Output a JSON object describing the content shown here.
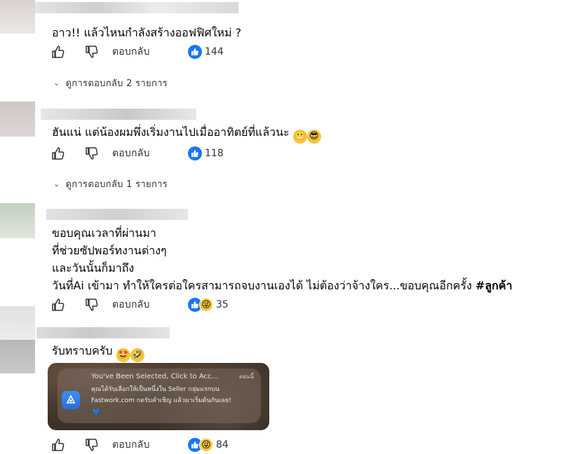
{
  "comments": [
    {
      "text_lines": [
        "อาว!! แล้วไหนกำลังสร้างออฟฟิศใหม่ ?"
      ],
      "reply_label": "ตอบกลับ",
      "reaction_count": "144",
      "view_replies": "ดูการตอบกลับ 2 รายการ"
    },
    {
      "text_lines": [
        "ฮันแน่ แต่น้องผมพึ่งเริ่มงานไปเมื่ออาทิตย์ที่แล้วนะ"
      ],
      "reply_label": "ตอบกลับ",
      "reaction_count": "118",
      "view_replies": "ดูการตอบกลับ 1 รายการ"
    },
    {
      "text_lines": [
        "ขอบคุณเวลาที่ผ่านมา",
        "ที่ช่วยซัปพอร์ทงานต่างๆ",
        "และวันนั้นก็มาถึง",
        "วันที่Ai เข้ามา ทำให้ใครต่อใครสามารถจบงานเองได้ ไม่ต้องว่าจ้างใคร...ขอบคุณอีกครั้ง "
      ],
      "hashtag": "#ลูกค้า",
      "reply_label": "ตอบกลับ",
      "reaction_count": "35"
    },
    {
      "text_lines": [
        "รับทราบครับ"
      ],
      "reply_label": "ตอบกลับ",
      "reaction_count": "84"
    }
  ],
  "notification": {
    "title": "You've Been Selected, Click to Acc...",
    "time": "ตอนนี้",
    "body_line1": "คุณได้รับเลือกให้เป็นหนึ่งใน Seller กลุ่มแรกบน",
    "body_line2": "Fastwork.com กดรับคำเชิญ แล้วมาเริ่มต้นกันเลย!",
    "heart": "💙"
  },
  "colors": {
    "like_blue": "#1877f2",
    "text": "#050505",
    "muted": "#65676b"
  },
  "icons": [
    "thumbs-up-icon",
    "thumbs-down-icon",
    "like-reaction-icon",
    "haha-reaction-icon",
    "chevron-down-icon"
  ]
}
